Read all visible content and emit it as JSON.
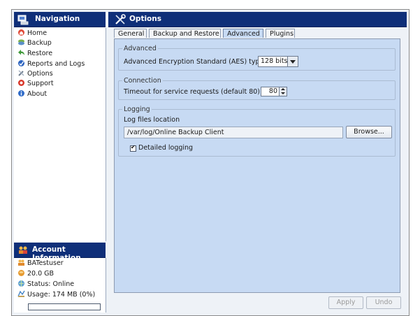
{
  "navigation": {
    "title": "Navigation",
    "items": [
      {
        "label": "Home"
      },
      {
        "label": "Backup"
      },
      {
        "label": "Restore"
      },
      {
        "label": "Reports and Logs"
      },
      {
        "label": "Options"
      },
      {
        "label": "Support"
      },
      {
        "label": "About"
      }
    ]
  },
  "account": {
    "title": "Account Information",
    "user": "BATestuser",
    "quota": "20.0 GB",
    "status": "Status: Online",
    "usage": "Usage: 174 MB (0%)",
    "usage_fraction": 0.0
  },
  "options": {
    "title": "Options",
    "tabs": [
      {
        "label": "General"
      },
      {
        "label": "Backup and Restore"
      },
      {
        "label": "Advanced",
        "active": true
      },
      {
        "label": "Plugins"
      }
    ],
    "advanced": {
      "group_label": "Advanced",
      "aes_label": "Advanced Encryption Standard (AES) type:",
      "aes_value": "128 bits"
    },
    "connection": {
      "group_label": "Connection",
      "timeout_label": "Timeout for service requests (default 80)",
      "timeout_value": "80"
    },
    "logging": {
      "group_label": "Logging",
      "location_label": "Log files location",
      "location_value": "/var/log/Online Backup Client",
      "browse_label": "Browse...",
      "detailed_label": "Detailed logging",
      "detailed_checked": true
    },
    "apply_label": "Apply",
    "undo_label": "Undo"
  },
  "colors": {
    "header_bg": "#0f2f79",
    "panel_bg": "#c7daf3"
  }
}
